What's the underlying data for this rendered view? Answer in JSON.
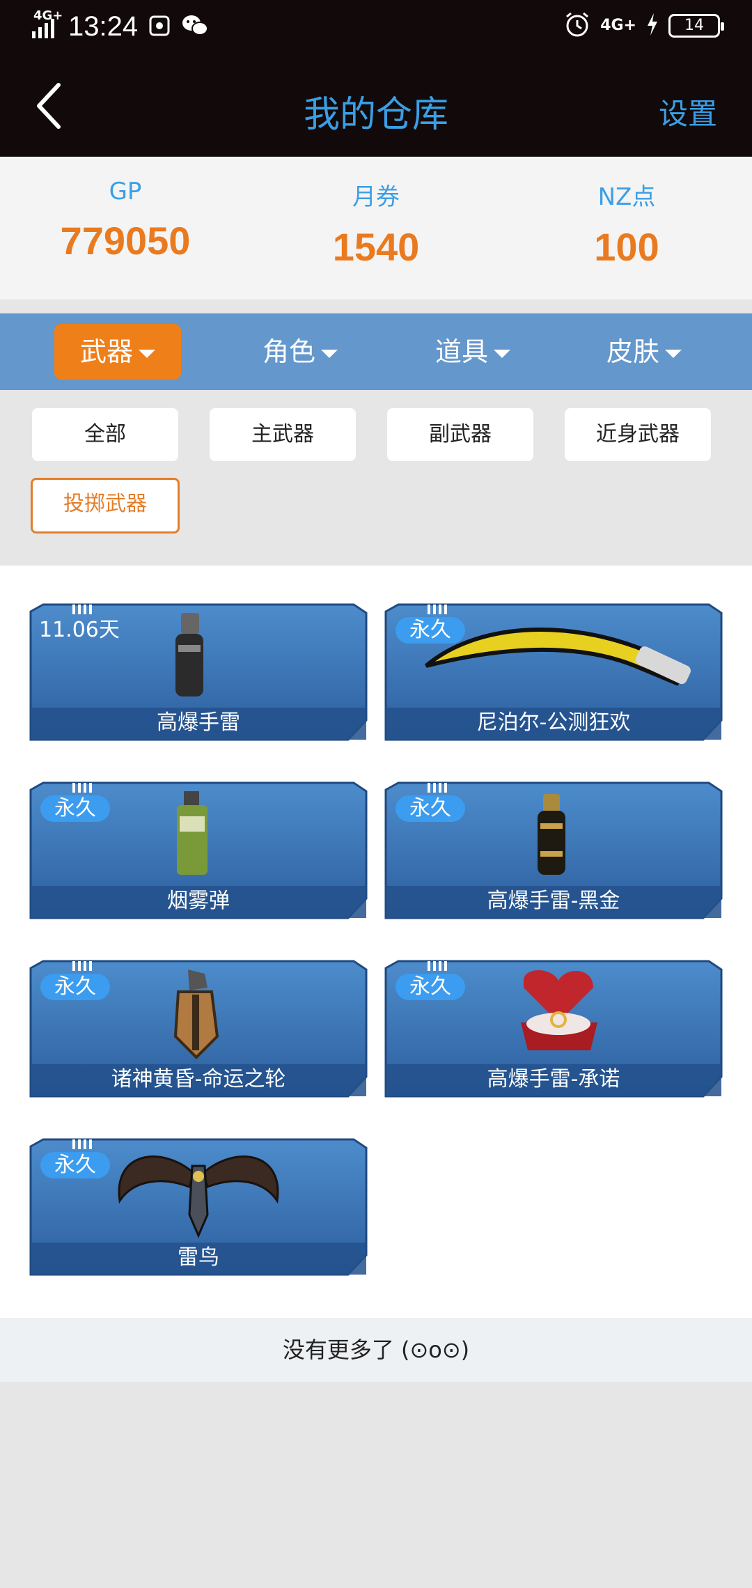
{
  "status_bar": {
    "network": "4G+",
    "time": "13:24",
    "network_right": "4G+",
    "battery": "14"
  },
  "header": {
    "title": "我的仓库",
    "settings_label": "设置"
  },
  "currencies": [
    {
      "label": "GP",
      "value": "779050"
    },
    {
      "label": "月券",
      "value": "1540"
    },
    {
      "label": "NZ点",
      "value": "100"
    }
  ],
  "categories": [
    {
      "label": "武器",
      "active": true
    },
    {
      "label": "角色",
      "active": false
    },
    {
      "label": "道具",
      "active": false
    },
    {
      "label": "皮肤",
      "active": false
    }
  ],
  "subfilters": [
    {
      "label": "全部",
      "active": false
    },
    {
      "label": "主武器",
      "active": false
    },
    {
      "label": "副武器",
      "active": false
    },
    {
      "label": "近身武器",
      "active": false
    },
    {
      "label": "投掷武器",
      "active": true
    }
  ],
  "items": [
    {
      "duration": "11.06天",
      "name": "高爆手雷",
      "icon": "grenade-icon"
    },
    {
      "duration": "永久",
      "name": "尼泊尔-公测狂欢",
      "icon": "knife-icon"
    },
    {
      "duration": "永久",
      "name": "烟雾弹",
      "icon": "smoke-grenade-icon"
    },
    {
      "duration": "永久",
      "name": "高爆手雷-黑金",
      "icon": "grenade-icon"
    },
    {
      "duration": "永久",
      "name": "诸神黄昏-命运之轮",
      "icon": "grenade-icon"
    },
    {
      "duration": "永久",
      "name": "高爆手雷-承诺",
      "icon": "ring-box-icon"
    },
    {
      "duration": "永久",
      "name": "雷鸟",
      "icon": "winged-grenade-icon"
    }
  ],
  "footer": {
    "text": "没有更多了 (⊙o⊙)"
  },
  "colors": {
    "accent_blue": "#3a9fe6",
    "orange": "#ea7a1f",
    "category_bar": "#6497cc",
    "card_blue": "#3f78b8"
  }
}
